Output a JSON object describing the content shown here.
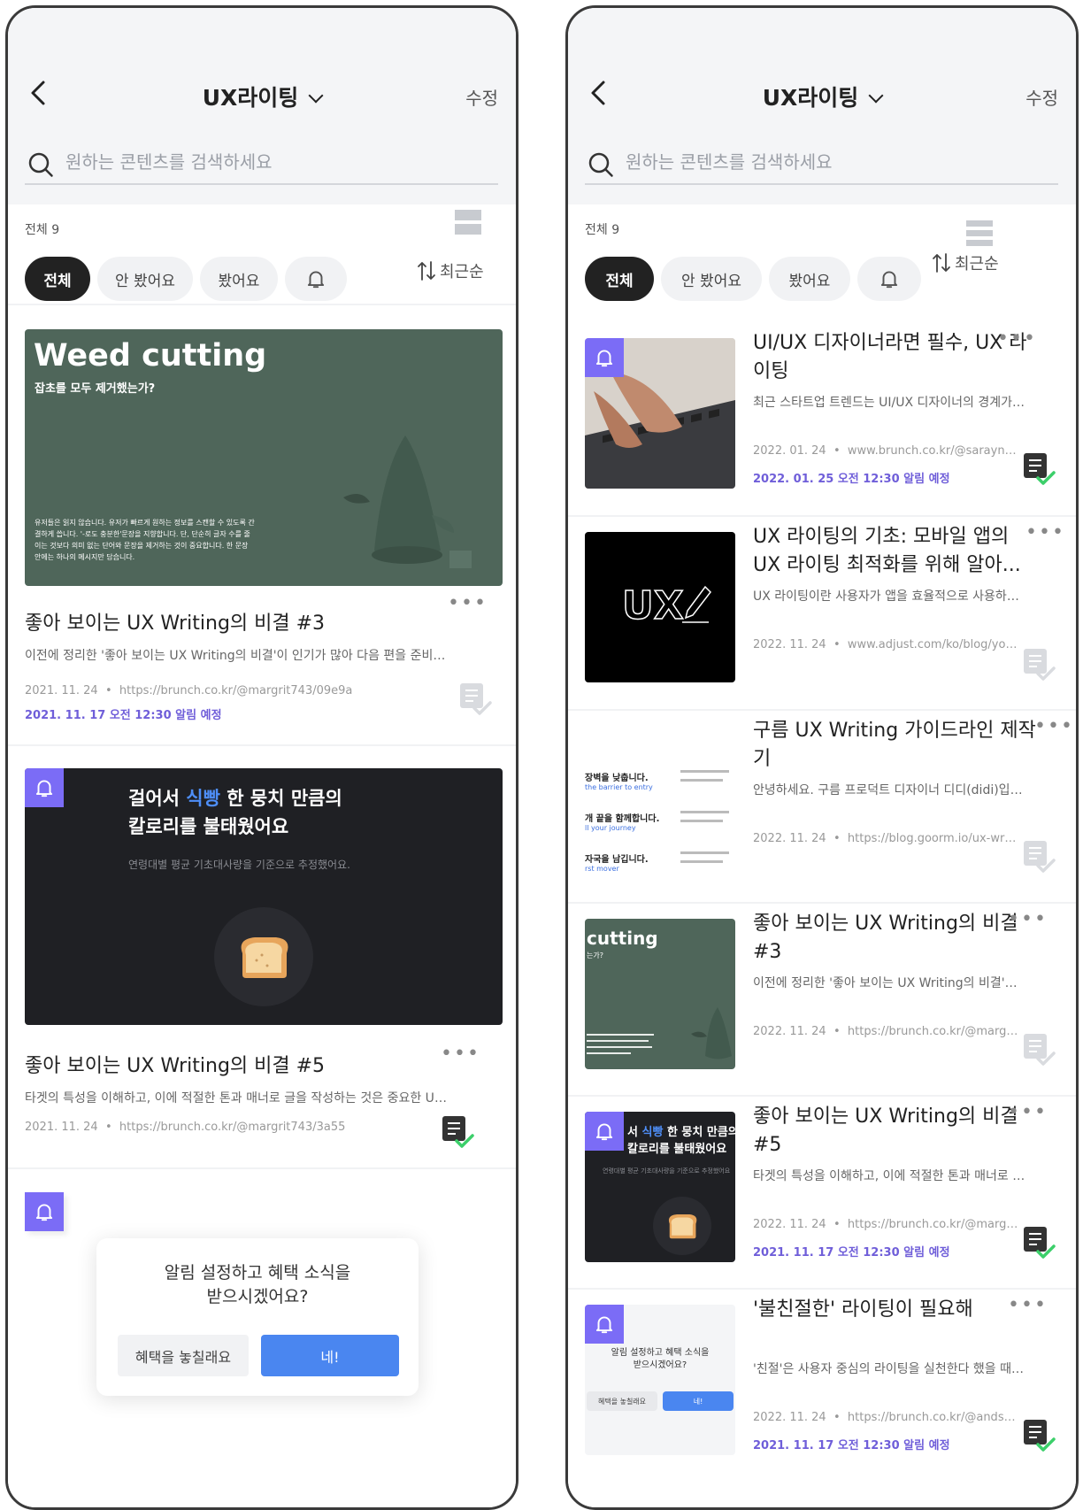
{
  "header": {
    "title": "UX라이팅",
    "edit_label": "수정",
    "search_placeholder": "원하는 콘텐츠를 검색하세요"
  },
  "count_label": "전체 9",
  "filters": [
    "전체",
    "안 봤어요",
    "봤어요"
  ],
  "sort_label": "최근순",
  "colors": {
    "accent": "#7b6cf6",
    "alarm_text": "#6f5ed9",
    "primary_button": "#4a86f0",
    "dark": "#222222"
  },
  "left": {
    "card1": {
      "thumb_title": "Weed cutting",
      "thumb_subtitle": "잡초를 모두 제거했는가?",
      "thumb_body": "유저들은 읽지 않습니다. 유저가 빠르게 원하는 정보를 스캔할 수 있도록 간결하게 씁니다. '-로도 충분한'문장을 지향합니다. 단, 단순히 글자 수를 줄이는 것보다 의미 없는 단어와 문장을 제거하는 것이 중요합니다. 한 문장 안에는 하나의 메시지만 담습니다.",
      "title": "좋아 보이는 UX Writing의 비결 #3",
      "desc": "이전에 정리한 '좋아 보이는 UX Writing의 비결'이 인기가 많아 다음 편을 준비해봤습...",
      "date": "2021. 11. 24",
      "url": "https://brunch.co.kr/@margrit743/09e9a",
      "alarm": "2021. 11. 17 오전 12:30 알림 예정"
    },
    "card2": {
      "thumb_line1_pre": "걸어서 ",
      "thumb_line1_hl": "식빵",
      "thumb_line1_post": " 한 뭉치 만큼의",
      "thumb_line2": "칼로리를 불태웠어요",
      "thumb_sub": "연령대별 평균 기초대사량을 기준으로 추정했어요.",
      "title": "좋아 보이는 UX Writing의 비결 #5",
      "desc": "타겟의 특성을 이해하고, 이에 적절한 톤과 매너로 글을 작성하는 것은 중요한 UX디...",
      "date": "2021. 11. 24",
      "url": "https://brunch.co.kr/@margrit743/3a55"
    },
    "dialog": {
      "line1": "알림 설정하고 혜택 소식을",
      "line2": "받으시겠어요?",
      "decline": "혜택을 놓칠래요",
      "accept": "네!"
    }
  },
  "right": {
    "items": [
      {
        "title": "UI/UX 디자이너라면 필수, UX 라이팅",
        "desc": "최근 스타트업 트렌드는 UI/UX 디자이너의 경계가 더...",
        "date": "2022. 01. 24",
        "url": "www.brunch.co.kr/@saraynde/...",
        "alarm": "2022. 01. 25 오전 12:30 알림 예정"
      },
      {
        "title": "UX 라이팅의 기초: 모바일 앱의 UX 라이팅 최적화를 위해 알아...",
        "desc": "UX 라이팅이란 사용자가 앱을 효율적으로 사용하고...",
        "date": "2022. 11. 24",
        "url": "www.adjust.com/ko/blog/your...",
        "thumb_text": "UX"
      },
      {
        "title": "구름 UX Writing 가이드라인 제작기",
        "desc": "안녕하세요. 구름 프로덕트 디자이너 디디(didi)입니...",
        "date": "2022. 11. 24",
        "url": "https://blog.goorm.io/ux-writin...",
        "thumb_lines": [
          {
            "ko": "장벽을 낮춥니다.",
            "en": "the barrier to entry"
          },
          {
            "ko": "개 끝을 함께합니다.",
            "en": "ll your journey"
          },
          {
            "ko": "자국을 남깁니다.",
            "en": "rst mover"
          }
        ]
      },
      {
        "title": "좋아 보이는 UX Writing의 비결 #3",
        "desc": "이전에 정리한 '좋아 보이는 UX Writing의 비결'이 인...",
        "date": "2022. 11. 24",
        "url": "https://brunch.co.kr/@margrit7...",
        "thumb_title": "cutting",
        "thumb_sub": "는가?"
      },
      {
        "title": "좋아 보이는 UX Writing의 비결 #5",
        "desc": "타겟의 특성을 이해하고, 이에 적절한 톤과 매너로 글...",
        "date": "2022. 11. 24",
        "url": "https://brunch.co.kr/@margrit7...",
        "alarm": "2021. 11. 17 오전 12:30 알림 예정",
        "thumb_line1_pre": "서 ",
        "thumb_line1_hl": "식빵",
        "thumb_line1_post": " 한 뭉치 만큼의",
        "thumb_line2": "칼로리를 불태웠어요",
        "thumb_sub": "연령대별 평균 기초대사량을 기준으로 추정했어요"
      },
      {
        "title": "'불친절한' 라이팅이 필요해",
        "desc": "'친절'은 사용자 중심의 라이팅을 실천한다 했을 때 가...",
        "date": "2022. 11. 24",
        "url": "https://brunch.co.kr/@andsalt...",
        "alarm": "2021. 11. 17 오전 12:30 알림 예정",
        "thumb_line1": "알림 설정하고 혜택 소식을",
        "thumb_line2": "받으시겠어요?",
        "thumb_decline": "혜택을 놓칠래요",
        "thumb_accept": "네!"
      }
    ]
  }
}
